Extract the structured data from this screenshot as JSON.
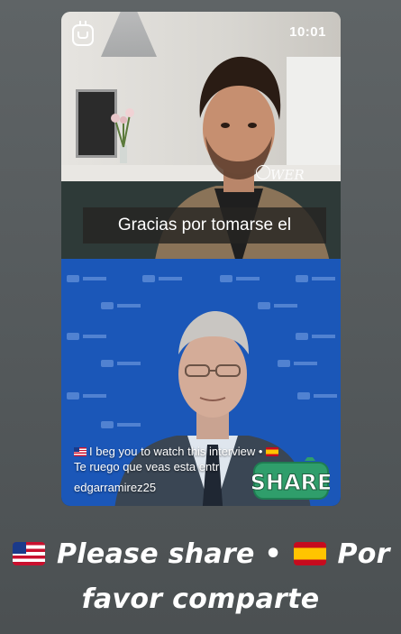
{
  "status_bar": {
    "time": "10:01"
  },
  "top_video": {
    "subtitle": "Gracias por tomarse el",
    "watermark": "WER"
  },
  "bottom_video": {
    "caption_line1": "I beg you to watch this interview •",
    "caption_line2": "Te ruego que veas esta entr",
    "username": "edgarramirez25",
    "sticker_text": "SHARE"
  },
  "story_text": {
    "part1": "Please share •",
    "part2": "Por",
    "part3": "favor comparte"
  },
  "colors": {
    "background": "#54595b",
    "video_bg_blue": "#1b57b8",
    "sticker_green": "#2f9e6b"
  },
  "icons": [
    "instagram-app-icon",
    "us-flag-icon",
    "spain-flag-icon",
    "share-sticker-icon"
  ]
}
